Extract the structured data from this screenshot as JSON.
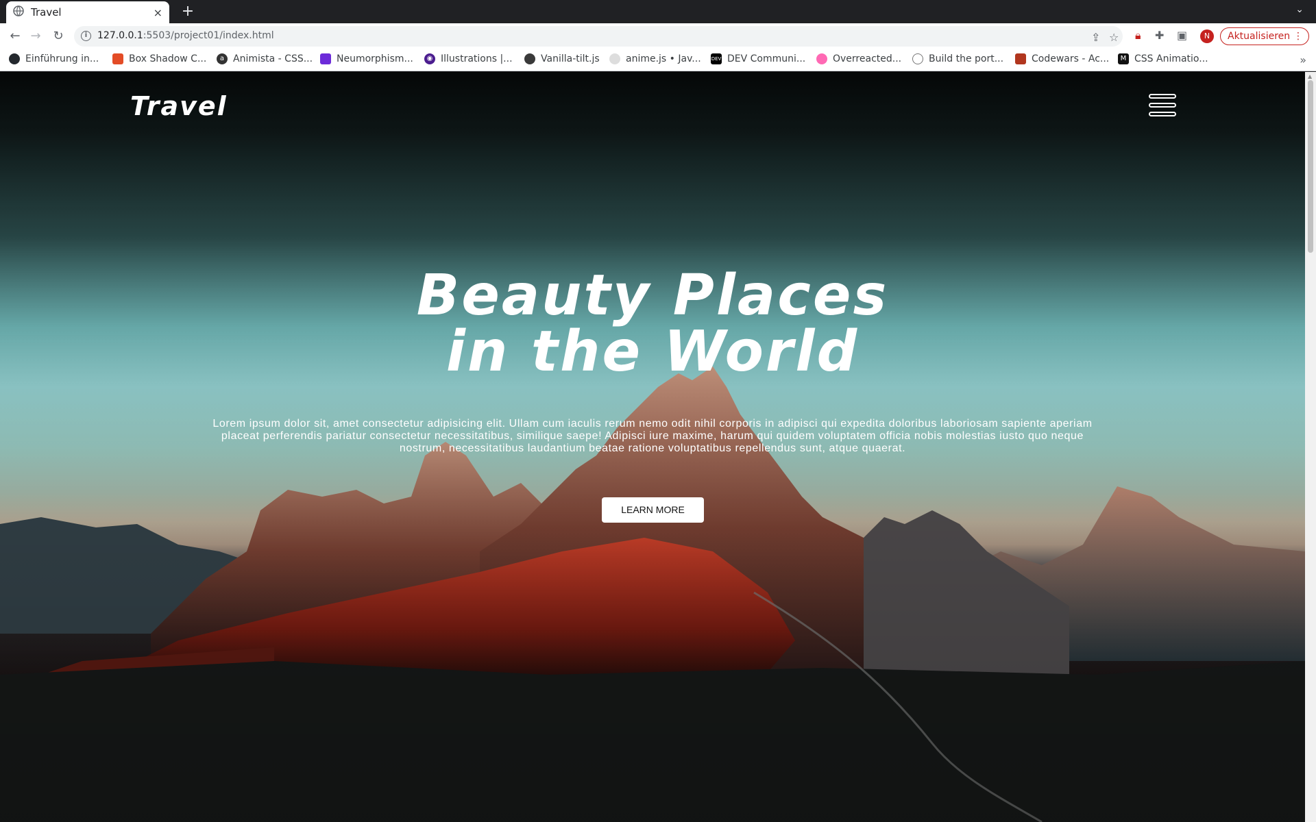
{
  "browser": {
    "tab_title": "Travel",
    "tab_close": "×",
    "new_tab": "+",
    "url_host": "127.0.0.1",
    "url_rest": ":5503/project01/index.html",
    "update_label": "Aktualisieren",
    "avatar_letter": "N"
  },
  "bookmarks": [
    {
      "label": "Einführung in...",
      "color": "#24292e"
    },
    {
      "label": "Box Shadow C...",
      "color": "#e34c26"
    },
    {
      "label": "Animista - CSS...",
      "color": "#333333"
    },
    {
      "label": "Neumorphism...",
      "color": "#6c2bd9"
    },
    {
      "label": "Illustrations |...",
      "color": "#4b1d8f"
    },
    {
      "label": "Vanilla-tilt.js",
      "color": "#3a3a3a"
    },
    {
      "label": "anime.js • Jav...",
      "color": "#dddddd"
    },
    {
      "label": "DEV Communi...",
      "color": "#000000"
    },
    {
      "label": "Overreacted...",
      "color": "#ff69b4"
    },
    {
      "label": "Build the port...",
      "color": "#555555"
    },
    {
      "label": "Codewars - Ac...",
      "color": "#b1361e"
    },
    {
      "label": "CSS Animatio...",
      "color": "#111111"
    }
  ],
  "page": {
    "logo": "Travel",
    "title_line1": "Beauty Places",
    "title_line2": "in the World",
    "body_text": "Lorem ipsum dolor sit, amet consectetur adipisicing elit. Ullam cum iaculis rerum nemo odit nihil corporis in adipisci qui expedita doloribus laboriosam sapiente aperiam placeat perferendis pariatur consectetur necessitatibus, similique saepe! Adipisci iure maxime, harum qui quidem voluptatem officia nobis molestias iusto quo neque nostrum, necessitatibus laudantium beatae ratione voluptatibus repellendus sunt, atque quaerat.",
    "button_label": "LEARN MORE"
  }
}
